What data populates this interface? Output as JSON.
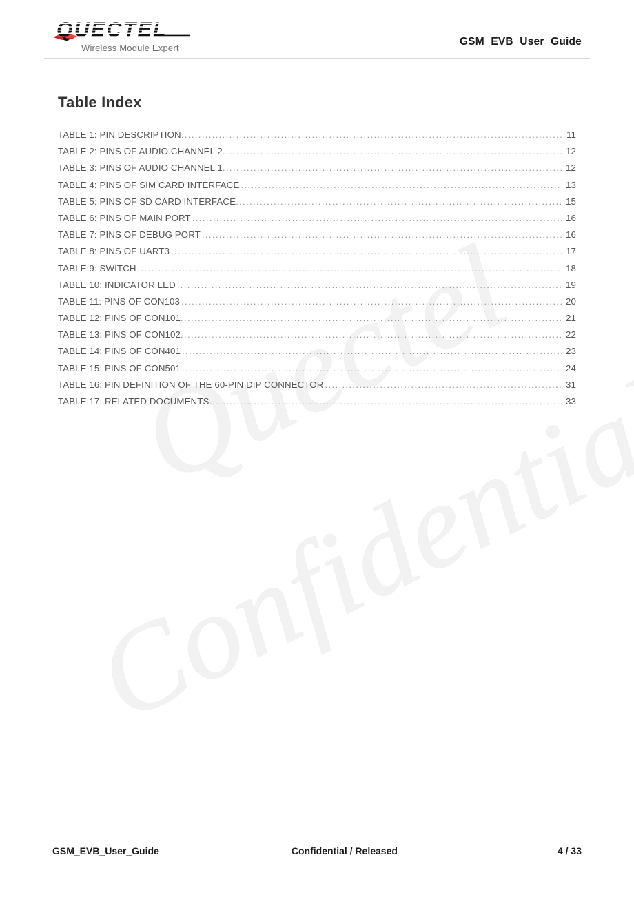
{
  "header": {
    "logo": {
      "wordmark": "QUECTEL",
      "tagline": "Wireless Module Expert",
      "swoosh_color": "#c1272d",
      "wordmark_color": "#111111"
    },
    "title": "GSM  EVB  User  Guide"
  },
  "main": {
    "page_title": "Table Index",
    "toc": [
      {
        "label": "TABLE 1: PIN DESCRIPTION",
        "page": "11"
      },
      {
        "label": "TABLE 2: PINS OF AUDIO CHANNEL 2",
        "page": "12"
      },
      {
        "label": "TABLE 3: PINS OF AUDIO CHANNEL 1",
        "page": "12"
      },
      {
        "label": "TABLE 4: PINS OF SIM CARD INTERFACE",
        "page": "13"
      },
      {
        "label": "TABLE 5: PINS OF SD CARD INTERFACE",
        "page": "15"
      },
      {
        "label": "TABLE 6: PINS OF MAIN PORT",
        "page": "16"
      },
      {
        "label": "TABLE 7: PINS OF DEBUG PORT",
        "page": "16"
      },
      {
        "label": "TABLE 8: PINS OF UART3",
        "page": "17"
      },
      {
        "label": "TABLE 9: SWITCH",
        "page": "18"
      },
      {
        "label": "TABLE 10: INDICATOR LED",
        "page": "19"
      },
      {
        "label": "TABLE 11: PINS OF CON103",
        "page": "20"
      },
      {
        "label": "TABLE 12: PINS OF CON101",
        "page": "21"
      },
      {
        "label": "TABLE 13: PINS OF CON102",
        "page": "22"
      },
      {
        "label": "TABLE 14: PINS OF CON401",
        "page": "23"
      },
      {
        "label": "TABLE 15: PINS OF CON501",
        "page": "24"
      },
      {
        "label": "TABLE 16: PIN DEFINITION OF THE 60-PIN DIP CONNECTOR",
        "page": "31"
      },
      {
        "label": "TABLE 17: RELATED DOCUMENTS",
        "page": "33"
      }
    ],
    "leader_dots": "................................................................................................................................................................................................"
  },
  "watermark": {
    "line1": "Quectel",
    "line2": "Confidential",
    "color": "#f2f2f2"
  },
  "footer": {
    "document_name": "GSM_EVB_User_Guide",
    "status": "Confidential / Released",
    "page_number": "4 / 33"
  }
}
